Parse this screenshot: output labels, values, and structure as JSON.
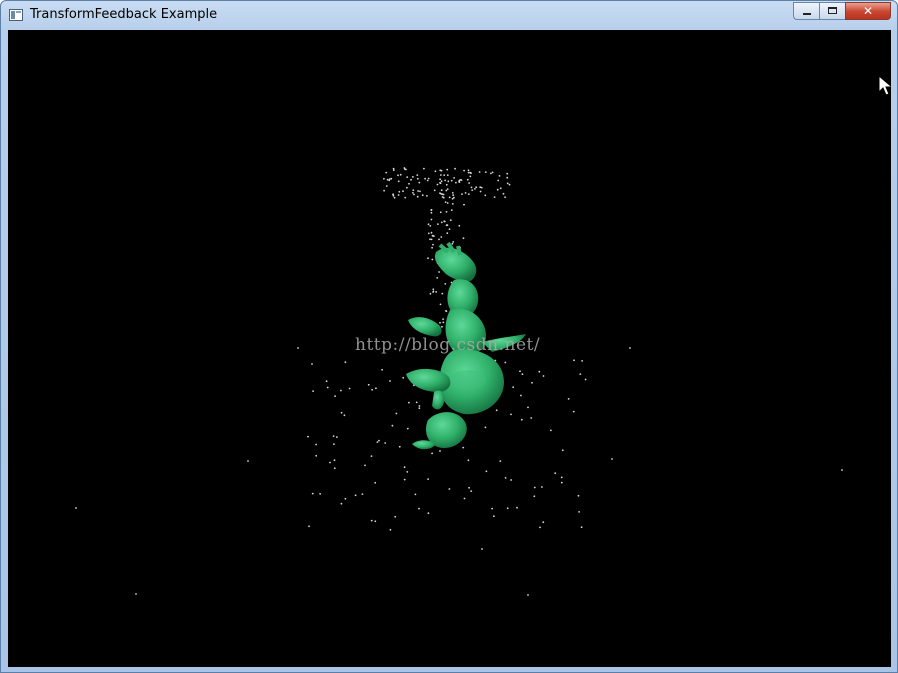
{
  "window": {
    "title": "TransformFeedback Example",
    "controls": {
      "close_label": "✕"
    }
  },
  "canvas": {
    "background": "#000000",
    "model_color": "#2fb06a",
    "particle_color": "#d8d8d8",
    "watermark": "http://blog.csdn.net/"
  }
}
